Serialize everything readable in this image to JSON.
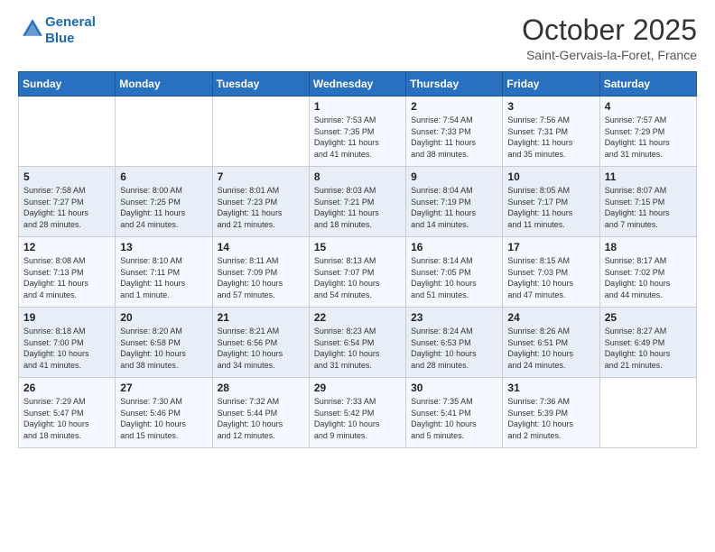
{
  "header": {
    "logo_line1": "General",
    "logo_line2": "Blue",
    "month_title": "October 2025",
    "location": "Saint-Gervais-la-Foret, France"
  },
  "days_of_week": [
    "Sunday",
    "Monday",
    "Tuesday",
    "Wednesday",
    "Thursday",
    "Friday",
    "Saturday"
  ],
  "weeks": [
    [
      {
        "day": "",
        "info": ""
      },
      {
        "day": "",
        "info": ""
      },
      {
        "day": "",
        "info": ""
      },
      {
        "day": "1",
        "info": "Sunrise: 7:53 AM\nSunset: 7:35 PM\nDaylight: 11 hours\nand 41 minutes."
      },
      {
        "day": "2",
        "info": "Sunrise: 7:54 AM\nSunset: 7:33 PM\nDaylight: 11 hours\nand 38 minutes."
      },
      {
        "day": "3",
        "info": "Sunrise: 7:56 AM\nSunset: 7:31 PM\nDaylight: 11 hours\nand 35 minutes."
      },
      {
        "day": "4",
        "info": "Sunrise: 7:57 AM\nSunset: 7:29 PM\nDaylight: 11 hours\nand 31 minutes."
      }
    ],
    [
      {
        "day": "5",
        "info": "Sunrise: 7:58 AM\nSunset: 7:27 PM\nDaylight: 11 hours\nand 28 minutes."
      },
      {
        "day": "6",
        "info": "Sunrise: 8:00 AM\nSunset: 7:25 PM\nDaylight: 11 hours\nand 24 minutes."
      },
      {
        "day": "7",
        "info": "Sunrise: 8:01 AM\nSunset: 7:23 PM\nDaylight: 11 hours\nand 21 minutes."
      },
      {
        "day": "8",
        "info": "Sunrise: 8:03 AM\nSunset: 7:21 PM\nDaylight: 11 hours\nand 18 minutes."
      },
      {
        "day": "9",
        "info": "Sunrise: 8:04 AM\nSunset: 7:19 PM\nDaylight: 11 hours\nand 14 minutes."
      },
      {
        "day": "10",
        "info": "Sunrise: 8:05 AM\nSunset: 7:17 PM\nDaylight: 11 hours\nand 11 minutes."
      },
      {
        "day": "11",
        "info": "Sunrise: 8:07 AM\nSunset: 7:15 PM\nDaylight: 11 hours\nand 7 minutes."
      }
    ],
    [
      {
        "day": "12",
        "info": "Sunrise: 8:08 AM\nSunset: 7:13 PM\nDaylight: 11 hours\nand 4 minutes."
      },
      {
        "day": "13",
        "info": "Sunrise: 8:10 AM\nSunset: 7:11 PM\nDaylight: 11 hours\nand 1 minute."
      },
      {
        "day": "14",
        "info": "Sunrise: 8:11 AM\nSunset: 7:09 PM\nDaylight: 10 hours\nand 57 minutes."
      },
      {
        "day": "15",
        "info": "Sunrise: 8:13 AM\nSunset: 7:07 PM\nDaylight: 10 hours\nand 54 minutes."
      },
      {
        "day": "16",
        "info": "Sunrise: 8:14 AM\nSunset: 7:05 PM\nDaylight: 10 hours\nand 51 minutes."
      },
      {
        "day": "17",
        "info": "Sunrise: 8:15 AM\nSunset: 7:03 PM\nDaylight: 10 hours\nand 47 minutes."
      },
      {
        "day": "18",
        "info": "Sunrise: 8:17 AM\nSunset: 7:02 PM\nDaylight: 10 hours\nand 44 minutes."
      }
    ],
    [
      {
        "day": "19",
        "info": "Sunrise: 8:18 AM\nSunset: 7:00 PM\nDaylight: 10 hours\nand 41 minutes."
      },
      {
        "day": "20",
        "info": "Sunrise: 8:20 AM\nSunset: 6:58 PM\nDaylight: 10 hours\nand 38 minutes."
      },
      {
        "day": "21",
        "info": "Sunrise: 8:21 AM\nSunset: 6:56 PM\nDaylight: 10 hours\nand 34 minutes."
      },
      {
        "day": "22",
        "info": "Sunrise: 8:23 AM\nSunset: 6:54 PM\nDaylight: 10 hours\nand 31 minutes."
      },
      {
        "day": "23",
        "info": "Sunrise: 8:24 AM\nSunset: 6:53 PM\nDaylight: 10 hours\nand 28 minutes."
      },
      {
        "day": "24",
        "info": "Sunrise: 8:26 AM\nSunset: 6:51 PM\nDaylight: 10 hours\nand 24 minutes."
      },
      {
        "day": "25",
        "info": "Sunrise: 8:27 AM\nSunset: 6:49 PM\nDaylight: 10 hours\nand 21 minutes."
      }
    ],
    [
      {
        "day": "26",
        "info": "Sunrise: 7:29 AM\nSunset: 5:47 PM\nDaylight: 10 hours\nand 18 minutes."
      },
      {
        "day": "27",
        "info": "Sunrise: 7:30 AM\nSunset: 5:46 PM\nDaylight: 10 hours\nand 15 minutes."
      },
      {
        "day": "28",
        "info": "Sunrise: 7:32 AM\nSunset: 5:44 PM\nDaylight: 10 hours\nand 12 minutes."
      },
      {
        "day": "29",
        "info": "Sunrise: 7:33 AM\nSunset: 5:42 PM\nDaylight: 10 hours\nand 9 minutes."
      },
      {
        "day": "30",
        "info": "Sunrise: 7:35 AM\nSunset: 5:41 PM\nDaylight: 10 hours\nand 5 minutes."
      },
      {
        "day": "31",
        "info": "Sunrise: 7:36 AM\nSunset: 5:39 PM\nDaylight: 10 hours\nand 2 minutes."
      },
      {
        "day": "",
        "info": ""
      }
    ]
  ]
}
